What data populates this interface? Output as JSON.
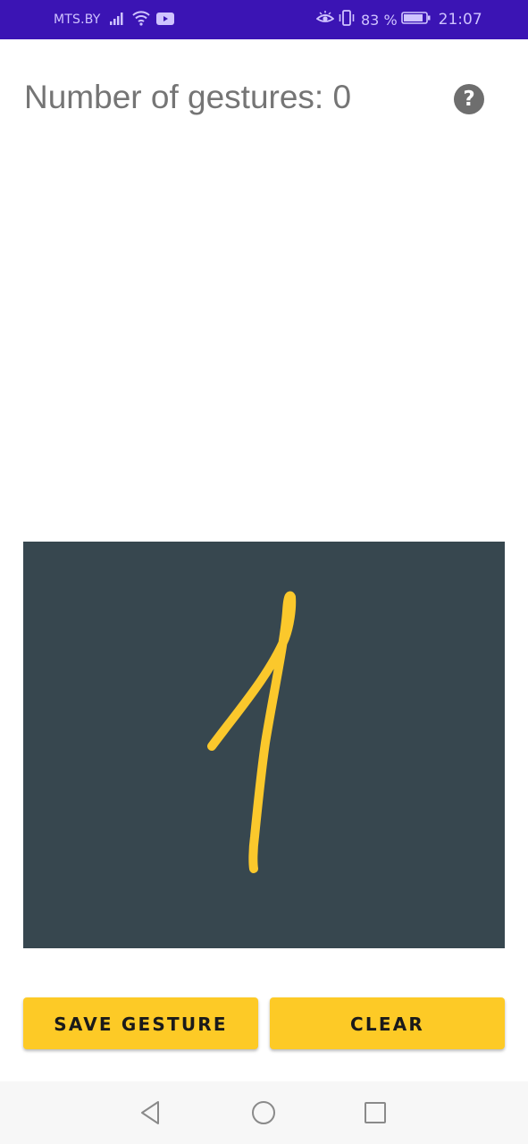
{
  "status_bar": {
    "carrier": "MTS.BY",
    "battery_percent": "83 %",
    "time": "21:07",
    "icons": [
      "signal-icon",
      "wifi-icon",
      "youtube-icon",
      "eye-icon",
      "vibrate-icon",
      "battery-icon"
    ]
  },
  "header": {
    "title": "Number of gestures: 0",
    "help_icon": "question-circle-icon",
    "help_glyph": "?"
  },
  "gesture_pad": {
    "background": "#37474f",
    "stroke_color": "#fbc82c",
    "drawn_gesture": "1"
  },
  "buttons": {
    "save_label": "SAVE GESTURE",
    "clear_label": "CLEAR",
    "accent": "#fdca26"
  },
  "nav_bar": {
    "back_icon": "back-triangle-icon",
    "home_icon": "home-circle-icon",
    "recent_icon": "recent-square-icon"
  },
  "colors": {
    "status_bar": "#3b14b4",
    "title_text": "#757575"
  }
}
